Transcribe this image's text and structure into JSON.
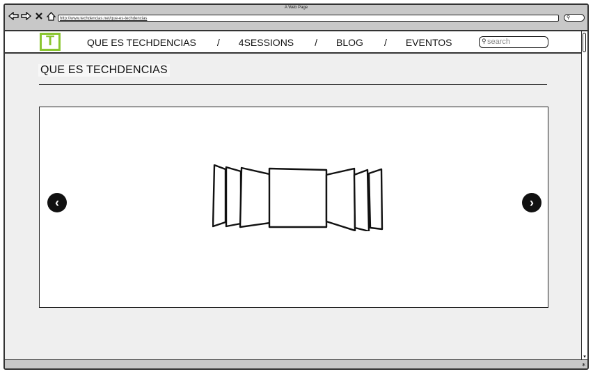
{
  "window": {
    "title": "A Web Page"
  },
  "browser": {
    "url": "http://www.techdencias.net/que-es-techdencias"
  },
  "header": {
    "menu": [
      {
        "label": "QUE ES TECHDENCIAS"
      },
      {
        "label": "4SESSIONS"
      },
      {
        "label": "BLOG"
      },
      {
        "label": "EVENTOS"
      }
    ],
    "separator": "/",
    "search_placeholder": "search"
  },
  "main": {
    "title": "QUE ES TECHDENCIAS"
  },
  "icons": {
    "back": "back-arrow-icon",
    "forward": "forward-arrow-icon",
    "stop": "close-icon",
    "home": "home-icon",
    "search": "search-icon",
    "prev": "chevron-left-icon",
    "next": "chevron-right-icon"
  },
  "colors": {
    "logo": "#8ac630",
    "background": "#efefef",
    "chrome": "#c8c8c8"
  }
}
